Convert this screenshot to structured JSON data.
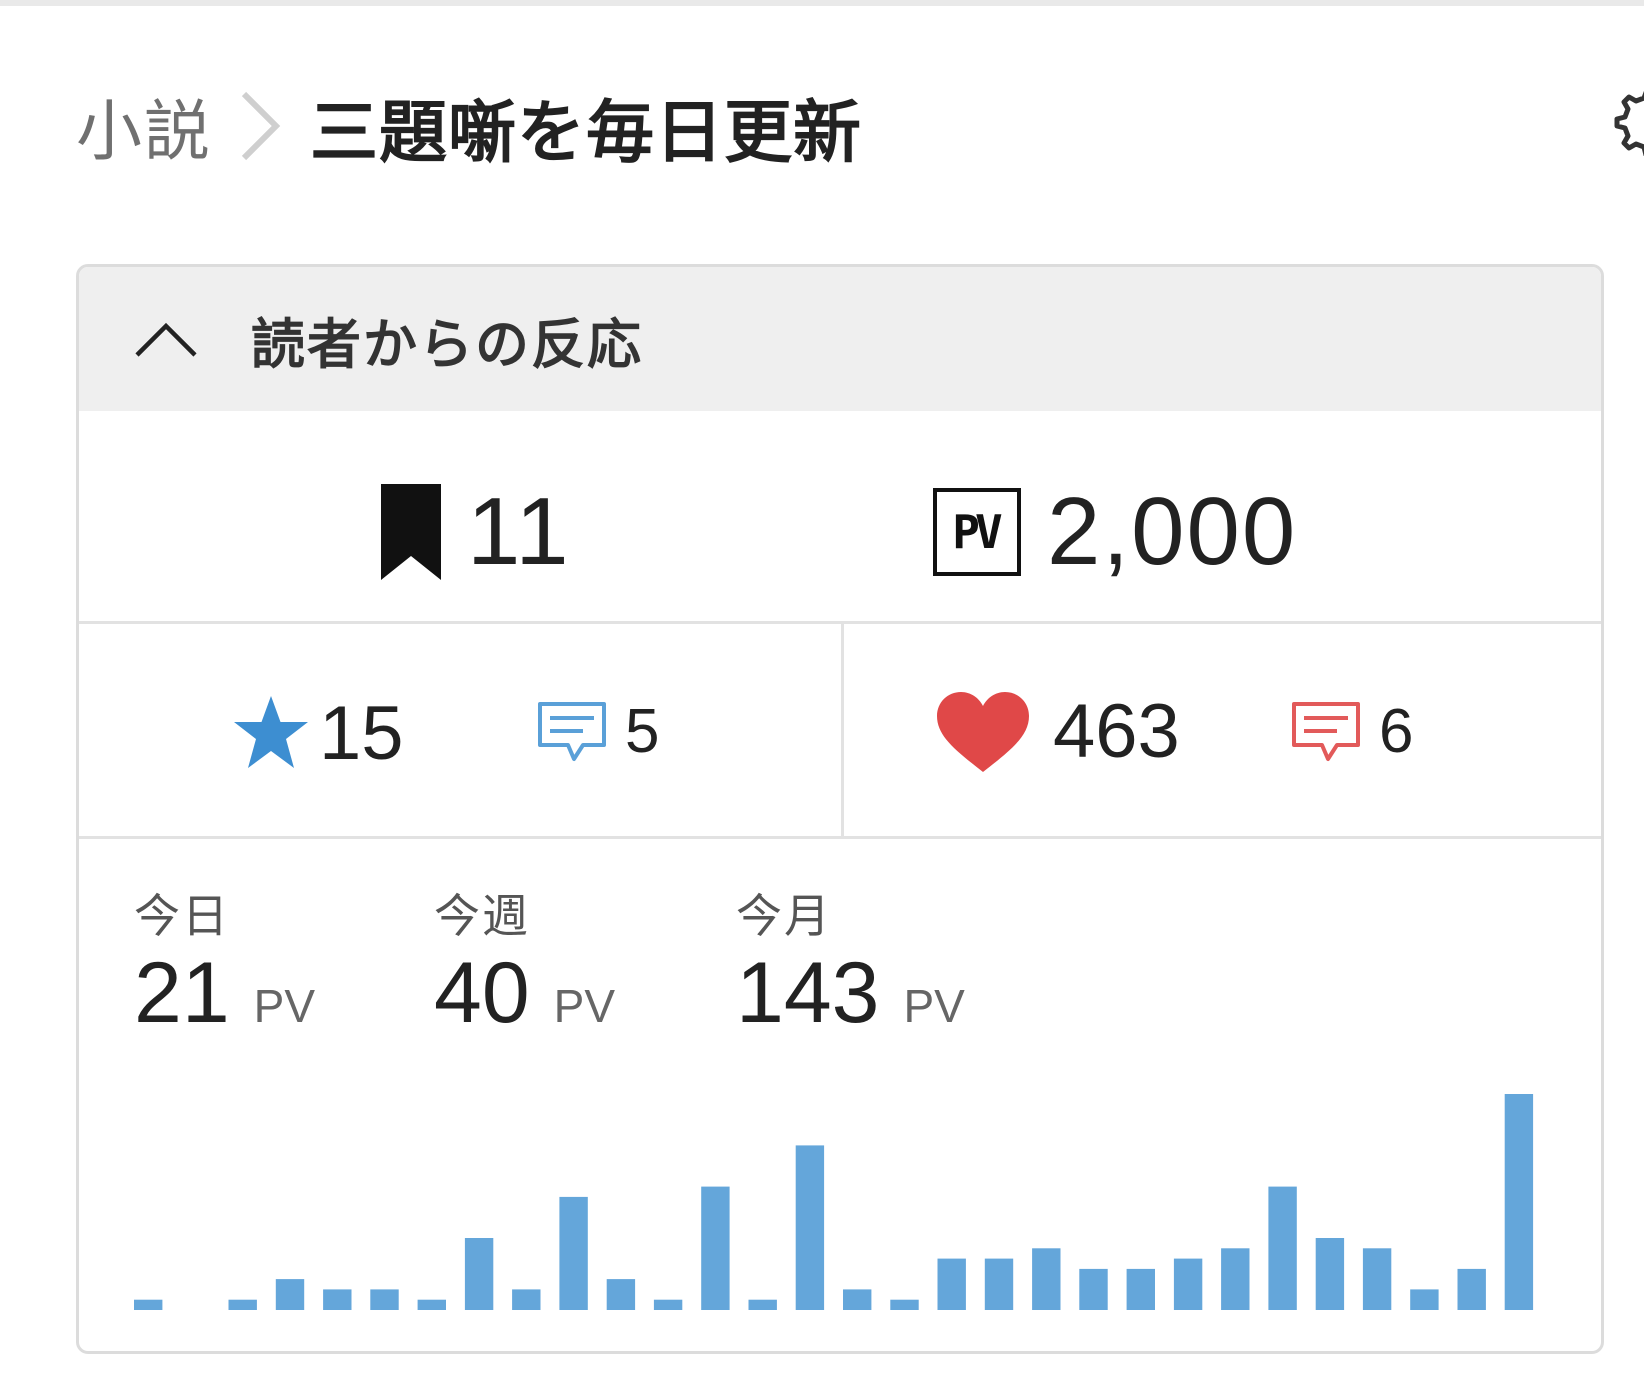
{
  "breadcrumb": {
    "parent": "小説",
    "current": "三題噺を毎日更新"
  },
  "icons": {
    "settings": "gear-icon",
    "separator": "chevron-right-icon",
    "collapse": "chevron-up-icon",
    "bookmark": "bookmark-icon",
    "pv": "pv-icon",
    "star": "star-icon",
    "heart": "heart-icon",
    "comment": "comment-icon"
  },
  "panel": {
    "title": "読者からの反応"
  },
  "totals": {
    "bookmarks": "11",
    "pv_badge": "PV",
    "pv": "2,000"
  },
  "reactions": {
    "stars": "15",
    "star_comments": "5",
    "hearts": "463",
    "heart_comments": "6"
  },
  "periods": [
    {
      "label": "今日",
      "value": "21",
      "unit": "PV"
    },
    {
      "label": "今週",
      "value": "40",
      "unit": "PV"
    },
    {
      "label": "今月",
      "value": "143",
      "unit": "PV"
    }
  ],
  "colors": {
    "bar": "#64a6da",
    "star": "#3d8ed1",
    "star_comment": "#5aa0d8",
    "heart": "#e04848",
    "heart_comment": "#e25a5a",
    "header_bg": "#efefef",
    "border": "#dcdcdc"
  },
  "chart_data": {
    "type": "bar",
    "values": [
      1,
      0,
      1,
      3,
      2,
      2,
      1,
      7,
      2,
      11,
      3,
      1,
      12,
      1,
      16,
      2,
      1,
      5,
      5,
      6,
      4,
      4,
      5,
      6,
      12,
      7,
      6,
      2,
      4,
      21
    ],
    "ylim": [
      0,
      21
    ],
    "grid": false,
    "legend": "none"
  }
}
